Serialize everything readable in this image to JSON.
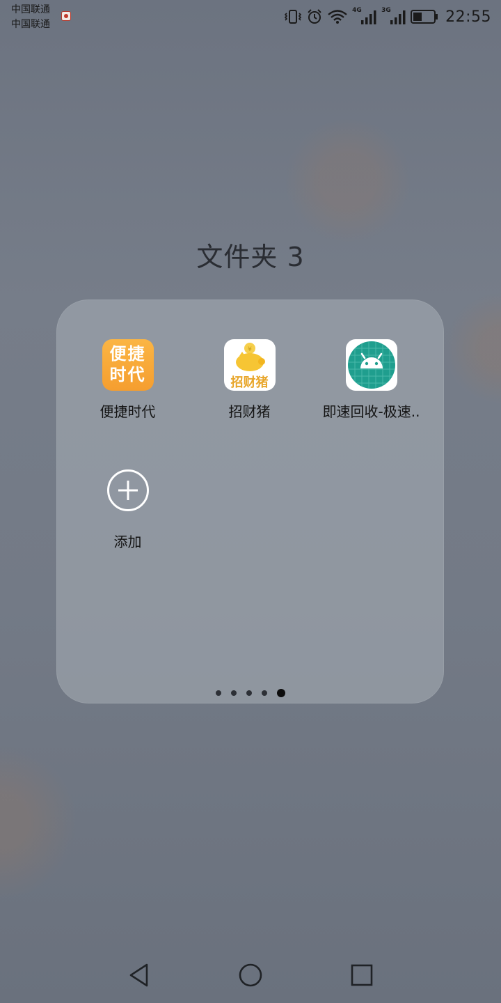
{
  "status_bar": {
    "carrier1": "中国联通",
    "carrier2": "中国联通",
    "net1": "4G",
    "net2": "3G",
    "time": "22:55"
  },
  "folder": {
    "title": "文件夹 3",
    "apps": [
      {
        "label": "便捷时代",
        "icon": "bianjie-shidai-icon",
        "icon_text_1": "便捷",
        "icon_text_2": "时代"
      },
      {
        "label": "招财猪",
        "icon": "zhaocai-pig-icon",
        "icon_text": "招财猪"
      },
      {
        "label": "即速回收-极速..",
        "icon": "android-icon"
      }
    ],
    "add_label": "添加",
    "page_count": 5,
    "current_page": 5
  },
  "colors": {
    "accent_orange": "#f7a93b",
    "android_teal": "#1f9e8e",
    "background": "#6d7480"
  }
}
